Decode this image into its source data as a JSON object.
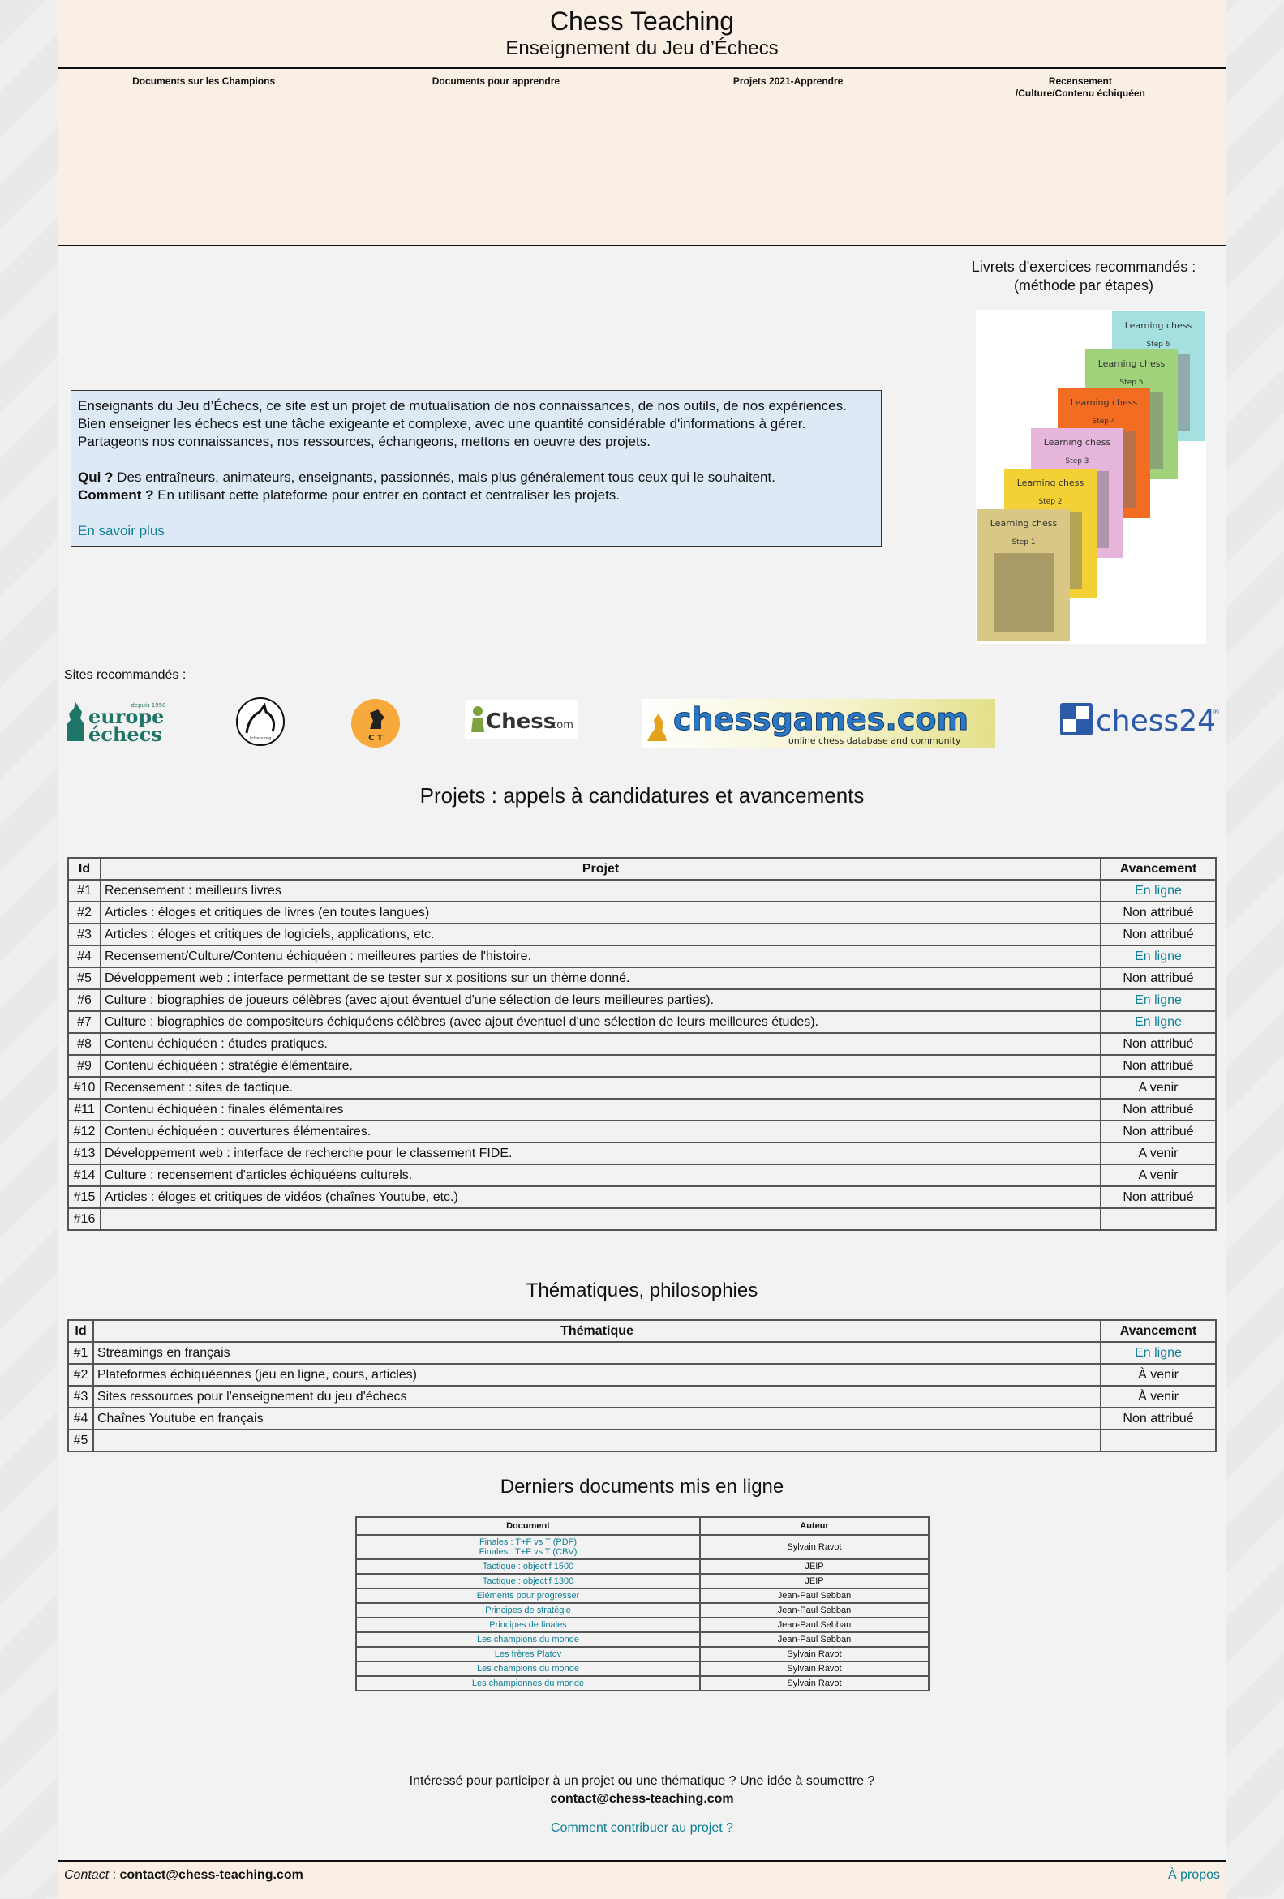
{
  "header": {
    "title": "Chess Teaching",
    "subtitle": "Enseignement du Jeu d’Échecs",
    "nav": [
      {
        "label": "Documents sur les Champions"
      },
      {
        "label": "Documents pour apprendre"
      },
      {
        "label": "Projets 2021-Apprendre"
      },
      {
        "label": "Recensement\n/Culture/Contenu échiquéen"
      }
    ]
  },
  "intro": {
    "p1": "Enseignants du Jeu d’Échecs, ce site est un projet de mutualisation de nos connaissances, de nos outils, de nos expériences.",
    "p2": "Bien enseigner les échecs est une tâche exigeante et complexe, avec une quantité considérable d'informations à gérer.",
    "p3": "Partageons nos connaissances, nos ressources, échangeons, mettons en oeuvre des projets.",
    "qui_label": "Qui ?",
    "qui_text": " Des entraîneurs, animateurs, enseignants, passionnés, mais plus généralement tous ceux qui le souhaitent.",
    "comment_label": "Comment ?",
    "comment_text": " En utilisant cette plateforme pour entrer en contact et centraliser les projets.",
    "more_link": "En savoir plus"
  },
  "books": {
    "title_line1": "Livrets d'exercices recommandés :",
    "title_line2": "(méthode par étapes)",
    "items": [
      {
        "title": "Learning chess",
        "step": "Step 1",
        "color": "#d8c785"
      },
      {
        "title": "Learning chess",
        "step": "Step 2",
        "color": "#f3d034"
      },
      {
        "title": "Learning chess",
        "step": "Step 3",
        "color": "#e6b5dc"
      },
      {
        "title": "Learning chess",
        "step": "Step 4",
        "color": "#f26c21"
      },
      {
        "title": "Learning chess",
        "step": "Step 5",
        "color": "#9fd27a"
      },
      {
        "title": "Learning chess",
        "step": "Step 6",
        "color": "#a6dfe0"
      }
    ]
  },
  "sites": {
    "label": "Sites recommandés :",
    "europe_top": "depuis 1950",
    "europe_l1": "europe",
    "europe_l2": "échecs",
    "lichess_small": "lichess.org",
    "ct_letters": "C T",
    "chesscom": "Chess",
    "chesscom_suffix": ".com",
    "chessgames": "chessgames.com",
    "chessgames_tag": "online chess database and community",
    "chess24": "chess24",
    "chess24_sup": "®"
  },
  "projects": {
    "title": "Projets : appels à candidatures et avancements",
    "headers": {
      "id": "Id",
      "name": "Projet",
      "status": "Avancement"
    },
    "rows": [
      {
        "id": "#1",
        "name": "Recensement : meilleurs livres",
        "status": "En ligne"
      },
      {
        "id": "#2",
        "name": "Articles : éloges et critiques de livres (en toutes langues)",
        "status": "Non attribué"
      },
      {
        "id": "#3",
        "name": "Articles : éloges et critiques de logiciels, applications, etc.",
        "status": "Non attribué"
      },
      {
        "id": "#4",
        "name": "Recensement/Culture/Contenu échiquéen : meilleures parties de l'histoire.",
        "status": "En ligne"
      },
      {
        "id": "#5",
        "name": "Développement web : interface permettant de se tester sur x positions sur un thème donné.",
        "status": "Non attribué"
      },
      {
        "id": "#6",
        "name": "Culture : biographies de joueurs célèbres (avec ajout éventuel d'une sélection de leurs meilleures parties).",
        "status": "En ligne"
      },
      {
        "id": "#7",
        "name": "Culture : biographies de compositeurs échiquéens célèbres (avec ajout éventuel d'une sélection de leurs meilleures études).",
        "status": "En ligne"
      },
      {
        "id": "#8",
        "name": "Contenu échiquéen : études pratiques.",
        "status": "Non attribué"
      },
      {
        "id": "#9",
        "name": "Contenu échiquéen : stratégie élémentaire.",
        "status": "Non attribué"
      },
      {
        "id": "#10",
        "name": "Recensement : sites de tactique.",
        "status": "A venir"
      },
      {
        "id": "#11",
        "name": "Contenu échiquéen : finales élémentaires",
        "status": "Non attribué"
      },
      {
        "id": "#12",
        "name": "Contenu échiquéen : ouvertures élémentaires.",
        "status": "Non attribué"
      },
      {
        "id": "#13",
        "name": "Développement web : interface de recherche pour le classement FIDE.",
        "status": "A venir"
      },
      {
        "id": "#14",
        "name": "Culture : recensement d'articles échiquéens culturels.",
        "status": "A venir"
      },
      {
        "id": "#15",
        "name": "Articles : éloges et critiques de vidéos (chaînes Youtube, etc.)",
        "status": "Non attribué"
      },
      {
        "id": "#16",
        "name": "",
        "status": ""
      }
    ]
  },
  "themes": {
    "title": "Thématiques, philosophies",
    "headers": {
      "id": "Id",
      "name": "Thématique",
      "status": "Avancement"
    },
    "rows": [
      {
        "id": "#1",
        "name": "Streamings en français",
        "status": "En ligne"
      },
      {
        "id": "#2",
        "name": "Plateformes échiquéennes (jeu en ligne, cours, articles)",
        "status": "À venir"
      },
      {
        "id": "#3",
        "name": "Sites ressources pour l'enseignement du jeu d'échecs",
        "status": "À venir"
      },
      {
        "id": "#4",
        "name": "Chaînes Youtube en français",
        "status": "Non attribué"
      },
      {
        "id": "#5",
        "name": "",
        "status": ""
      }
    ]
  },
  "documents": {
    "title": "Derniers documents mis en ligne",
    "headers": {
      "doc": "Document",
      "author": "Auteur"
    },
    "rows": [
      {
        "doc": "Finales : T+F vs T (PDF)",
        "doc2": "Finales : T+F vs T (CBV)",
        "author": "Sylvain Ravot"
      },
      {
        "doc": "Tactique : objectif 1500",
        "doc2": "",
        "author": "JEIP"
      },
      {
        "doc": "Tactique : objectif 1300",
        "doc2": "",
        "author": "JEIP"
      },
      {
        "doc": "Eléments pour progresser",
        "doc2": "",
        "author": "Jean-Paul Sebban"
      },
      {
        "doc": "Principes de stratégie",
        "doc2": "",
        "author": "Jean-Paul Sebban"
      },
      {
        "doc": "Principes de finales",
        "doc2": "",
        "author": "Jean-Paul Sebban"
      },
      {
        "doc": "Les champions du monde",
        "doc2": "",
        "author": "Jean-Paul Sebban"
      },
      {
        "doc": "Les frères Platov",
        "doc2": "",
        "author": "Sylvain Ravot"
      },
      {
        "doc": "Les champions du monde",
        "doc2": "",
        "author": "Sylvain Ravot"
      },
      {
        "doc": "Les championnes du monde",
        "doc2": "",
        "author": "Sylvain Ravot"
      }
    ]
  },
  "contact": {
    "question": "Intéressé pour participer à un projet ou une thématique ? Une idée à soumettre ?",
    "email": "contact@chess-teaching.com",
    "contribute_link": "Comment contribuer au projet ?"
  },
  "footer": {
    "contact_label": "Contact",
    "separator": " : ",
    "email": "contact@chess-teaching.com",
    "about": "À propos"
  },
  "colors": {
    "link": "#0e7f95",
    "header_bg": "#f9efe4",
    "intro_bg": "#ddeaf6"
  }
}
